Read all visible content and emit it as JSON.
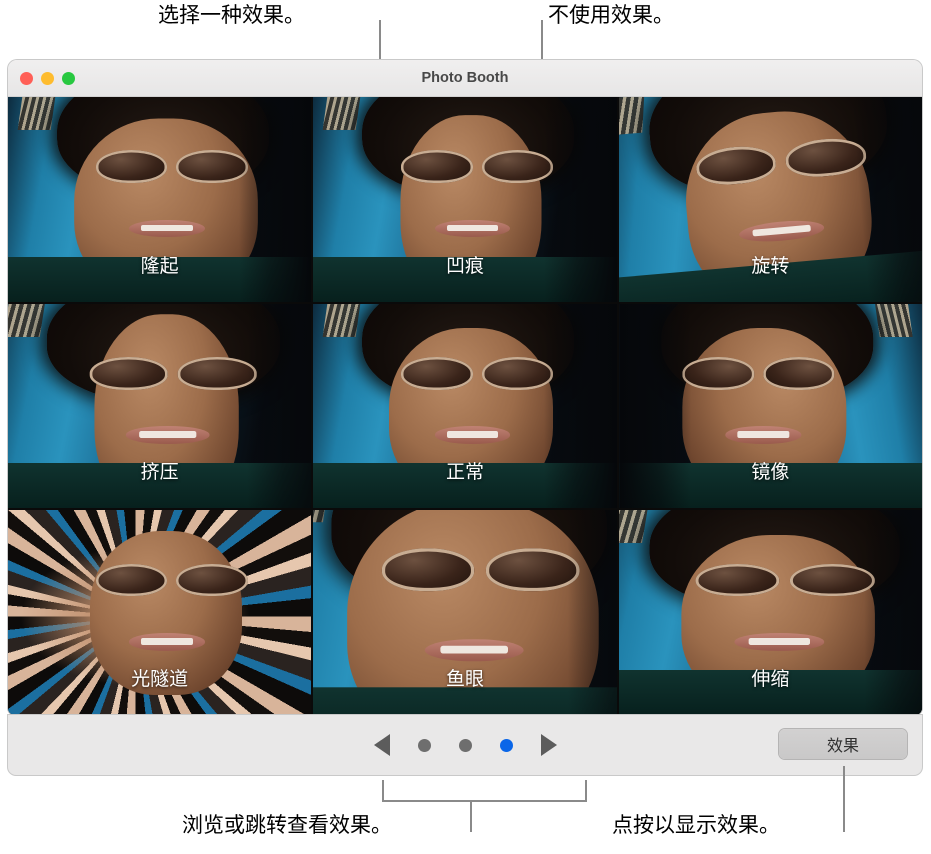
{
  "window": {
    "title": "Photo Booth",
    "traffic_lights": [
      {
        "name": "close-button",
        "color": "#ff5f57"
      },
      {
        "name": "minimize-button",
        "color": "#febc2e"
      },
      {
        "name": "zoom-button",
        "color": "#28c840"
      }
    ]
  },
  "grid": {
    "cells": [
      {
        "label": "隆起",
        "fx": "fx-bulge",
        "selected": false
      },
      {
        "label": "凹痕",
        "fx": "fx-dent",
        "selected": false
      },
      {
        "label": "旋转",
        "fx": "fx-twirl",
        "selected": false
      },
      {
        "label": "挤压",
        "fx": "fx-squeeze",
        "selected": false
      },
      {
        "label": "正常",
        "fx": "fx-normal",
        "selected": true
      },
      {
        "label": "镜像",
        "fx": "fx-mirror",
        "selected": false
      },
      {
        "label": "光隧道",
        "fx": "fx-tunnel",
        "selected": false
      },
      {
        "label": "鱼眼",
        "fx": "fx-fisheye",
        "selected": false
      },
      {
        "label": "伸缩",
        "fx": "fx-stretch",
        "selected": false
      }
    ]
  },
  "toolbar": {
    "previous_label": "◀",
    "next_label": "▶",
    "page_dots": [
      {
        "active": false
      },
      {
        "active": false
      },
      {
        "active": true
      }
    ],
    "effects_button_label": "效果",
    "accent_color": "#0a66e8"
  },
  "annotations": {
    "choose_effect": "选择一种效果。",
    "no_effect": "不使用效果。",
    "browse_effects": "浏览或跳转查看效果。",
    "click_to_show": "点按以显示效果。"
  }
}
